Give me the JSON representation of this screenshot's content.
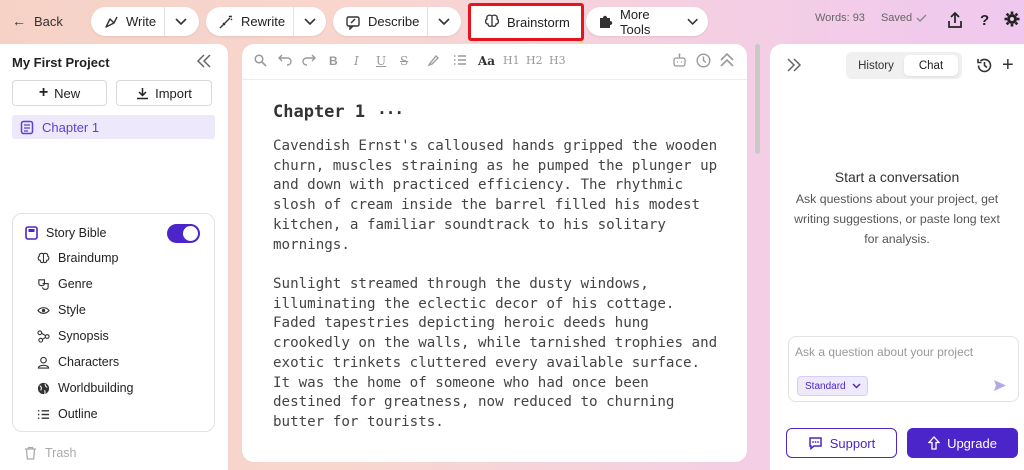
{
  "topbar": {
    "back_label": "Back",
    "tools": [
      {
        "label": "Write",
        "icon": "pen-nib-icon"
      },
      {
        "label": "Rewrite",
        "icon": "magic-pen-icon"
      },
      {
        "label": "Describe",
        "icon": "describe-icon"
      },
      {
        "label": "Brainstorm",
        "icon": "brain-icon"
      },
      {
        "label": "More Tools",
        "icon": "puzzle-icon"
      }
    ],
    "words_label": "Words: 93",
    "saved_label": "Saved",
    "help_label": "?"
  },
  "sidebar": {
    "project_title": "My First Project",
    "new_label": "New",
    "import_label": "Import",
    "chapter_label": "Chapter 1",
    "story_bible": {
      "title": "Story Bible",
      "enabled": true,
      "items": [
        {
          "label": "Braindump",
          "icon": "brain-icon"
        },
        {
          "label": "Genre",
          "icon": "masks-icon"
        },
        {
          "label": "Style",
          "icon": "style-icon"
        },
        {
          "label": "Synopsis",
          "icon": "synopsis-icon"
        },
        {
          "label": "Characters",
          "icon": "person-icon"
        },
        {
          "label": "Worldbuilding",
          "icon": "globe-icon"
        },
        {
          "label": "Outline",
          "icon": "list-icon"
        }
      ]
    },
    "trash_label": "Trash"
  },
  "editor": {
    "toolbar": {
      "font_size_label": "Aa",
      "h1_label": "H1",
      "h2_label": "H2",
      "h3_label": "H3",
      "bold_label": "B",
      "italic_label": "I",
      "underline_label": "U",
      "strike_label": "S"
    },
    "chapter_title": "Chapter 1",
    "more_label": "···",
    "paragraphs": [
      "Cavendish Ernst's calloused hands gripped the wooden churn, muscles straining as he pumped the plunger up and down with practiced efficiency. The rhythmic slosh of cream inside the barrel filled his modest kitchen, a familiar soundtrack to his solitary mornings.",
      "Sunlight streamed through the dusty windows, illuminating the eclectic decor of his cottage. Faded tapestries depicting heroic deeds hung crookedly on the walls, while tarnished trophies and exotic trinkets cluttered every available surface. It was the home of someone who had once been destined for greatness, now reduced to churning butter for tourists."
    ]
  },
  "chat_panel": {
    "tab_history": "History",
    "tab_chat": "Chat",
    "empty_title": "Start a conversation",
    "empty_desc": "Ask questions about your project, get writing suggestions, or paste long text for analysis.",
    "input_placeholder": "Ask a question about your project",
    "mode_label": "Standard",
    "support_label": "Support",
    "upgrade_label": "Upgrade"
  },
  "colors": {
    "accent": "#4b25c9",
    "highlight_box": "#e6141c",
    "annotation_arrow": "#f5f21a"
  }
}
